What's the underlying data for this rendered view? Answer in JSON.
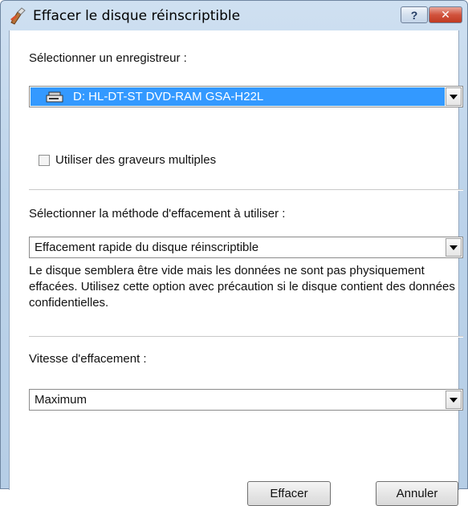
{
  "window": {
    "title": "Effacer le disque réinscriptible",
    "help_label": "?",
    "close_label": "✕"
  },
  "recorder": {
    "label": "Sélectionner un enregistreur :",
    "selected": "D: HL-DT-ST DVD-RAM GSA-H22L",
    "multi_label": "Utiliser des graveurs multiples",
    "multi_checked": false
  },
  "method": {
    "label": "Sélectionner la méthode d'effacement à utiliser :",
    "selected": "Effacement rapide du disque réinscriptible",
    "description": "Le disque semblera être vide mais les données ne sont pas physiquement effacées. Utilisez cette option avec précaution si le disque contient des données confidentielles."
  },
  "speed": {
    "label": "Vitesse d'effacement :",
    "selected": "Maximum"
  },
  "buttons": {
    "erase_label": "Effacer",
    "cancel_label": "Annuler"
  },
  "icons": {
    "app": "eraser-disc-icon",
    "drive": "optical-drive-icon"
  },
  "colors": {
    "selection": "#3399ff",
    "close": "#c8462e"
  }
}
